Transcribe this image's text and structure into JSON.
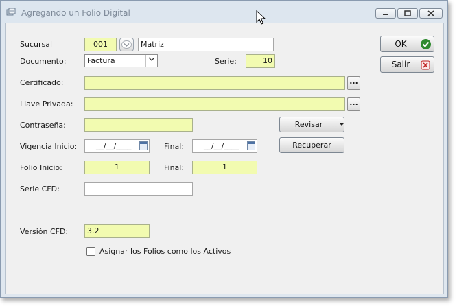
{
  "window": {
    "title": "Agregando un Folio Digital"
  },
  "form": {
    "sucursal_label": "Sucursal",
    "sucursal_code": "001",
    "sucursal_name": "Matriz",
    "documento_label": "Documento:",
    "documento_value": "Factura",
    "serie_label": "Serie:",
    "serie_value": "10",
    "certificado_label": "Certificado:",
    "certificado_value": "",
    "llave_label": "Llave Privada:",
    "llave_value": "",
    "contrasena_label": "Contraseña:",
    "contrasena_value": "",
    "vigencia_label": "Vigencia Inicio:",
    "vigencia_inicio_value": "__/__/____",
    "vigencia_final_label": "Final:",
    "vigencia_final_value": "__/__/____",
    "folio_label": "Folio Inicio:",
    "folio_inicio_value": "1",
    "folio_final_label": "Final:",
    "folio_final_value": "1",
    "serie_cfd_label": "Serie CFD:",
    "serie_cfd_value": "",
    "version_label": "Versión CFD:",
    "version_value": "3.2",
    "checkbox_label": "Asignar los Folios como los Activos",
    "checkbox_checked": false
  },
  "buttons": {
    "ok": "OK",
    "salir": "Salir",
    "revisar": "Revisar",
    "recuperar": "Recuperar",
    "dots": "..."
  },
  "icons": {
    "ok_icon": "check-circle-icon",
    "salir_icon": "cancel-x-icon",
    "calendar": "calendar-icon",
    "dropdown": "chevron-down-icon"
  },
  "colors": {
    "field_bg": "#f2fbb0",
    "ok_green": "#2e8a2e",
    "salir_red": "#c02424"
  }
}
